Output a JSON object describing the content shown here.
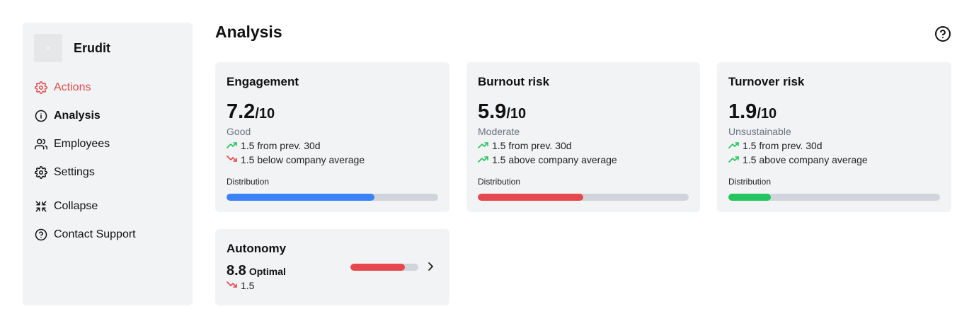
{
  "app": {
    "name": "Erudit"
  },
  "sidebar": {
    "items": [
      {
        "label": "Actions",
        "icon": "gear-icon",
        "color": "#e24b4b"
      },
      {
        "label": "Analysis",
        "icon": "info-icon"
      },
      {
        "label": "Employees",
        "icon": "users-icon"
      },
      {
        "label": "Settings",
        "icon": "gear-icon"
      },
      {
        "label": "Collapse",
        "icon": "collapse-icon"
      },
      {
        "label": "Contact Support",
        "icon": "help-icon"
      }
    ]
  },
  "header": {
    "title": "Analysis",
    "help_icon": "help-icon"
  },
  "cards": [
    {
      "title": "Engagement",
      "score": "7.2",
      "out_of": "/10",
      "label": "Good",
      "trend1": {
        "direction": "up",
        "text": "1.5 from prev. 30d"
      },
      "trend2": {
        "direction": "down",
        "text": "1.5 below company average"
      },
      "distribution_label": "Distribution",
      "distribution": 0.7,
      "color": "#3b82f6"
    },
    {
      "title": "Burnout risk",
      "score": "5.9",
      "out_of": "/10",
      "label": "Moderate",
      "trend1": {
        "direction": "up",
        "text": "1.5 from prev. 30d"
      },
      "trend2": {
        "direction": "up",
        "text": "1.5 above company average"
      },
      "distribution_label": "Distribution",
      "distribution": 0.5,
      "color": "#e5484d"
    },
    {
      "title": "Turnover risk",
      "score": "1.9",
      "out_of": "/10",
      "label": "Unsustainable",
      "trend1": {
        "direction": "up",
        "text": "1.5 from prev. 30d"
      },
      "trend2": {
        "direction": "up",
        "text": "1.5 above company average"
      },
      "distribution_label": "Distribution",
      "distribution": 0.2,
      "color": "#22c55e"
    }
  ],
  "autonomy": {
    "title": "Autonomy",
    "score": "8.8",
    "tag": "Optimal",
    "trend": {
      "direction": "down",
      "text": "1.5"
    },
    "distribution": 0.8,
    "color": "#e5484d",
    "chevron_icon": "chevron-right-icon"
  },
  "colors": {
    "up": "#22c55e",
    "down": "#e5484d"
  }
}
